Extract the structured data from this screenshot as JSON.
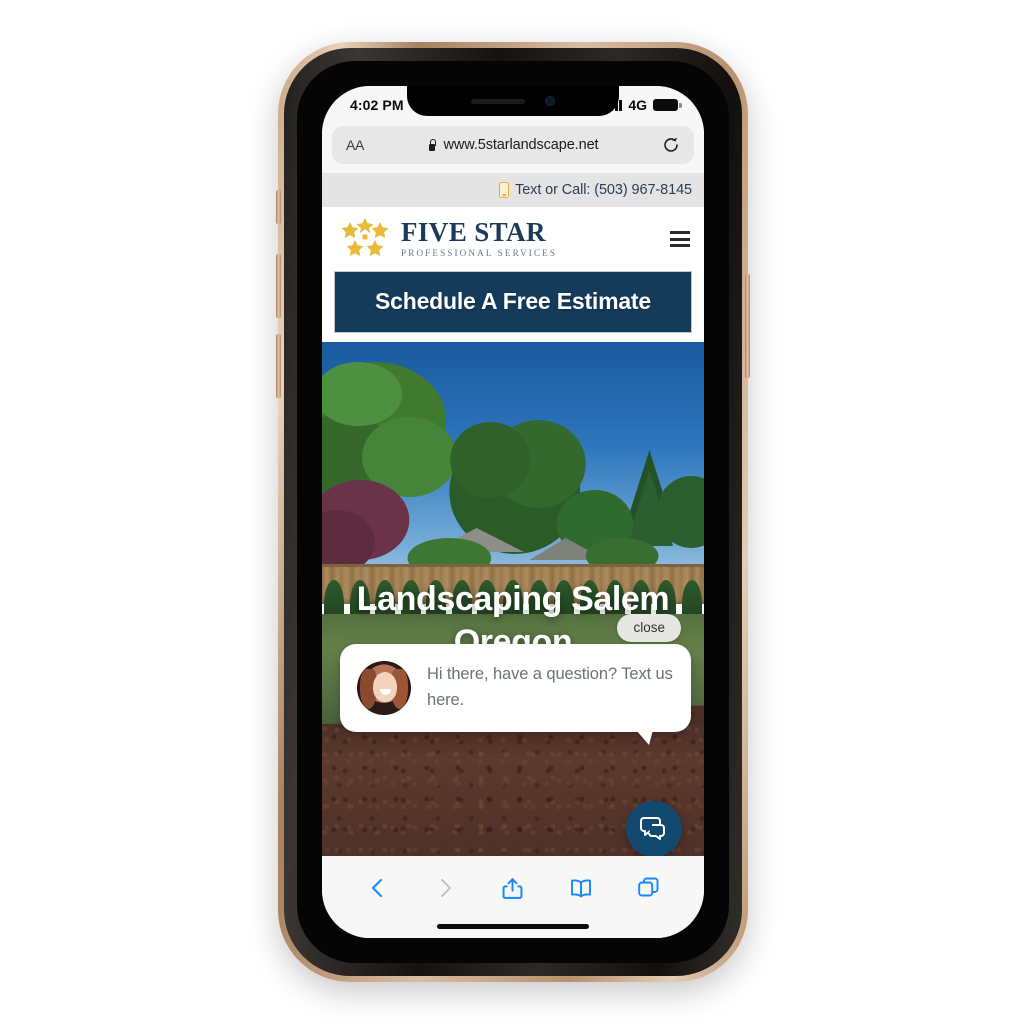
{
  "device": {
    "status_bar": {
      "time": "4:02 PM",
      "network": "4G",
      "signal_icon": "signal-bars-icon",
      "battery_icon": "battery-icon"
    },
    "frame_color": "#c8a584"
  },
  "browser": {
    "name": "Safari",
    "url_bar": {
      "reader_button": "AA",
      "lock_icon": "lock-icon",
      "url": "www.5starlandscape.net",
      "reload_icon": "reload-icon"
    },
    "toolbar": [
      {
        "name": "back-button",
        "icon": "chevron-left-icon",
        "enabled": true,
        "color": "#1a86ff"
      },
      {
        "name": "forward-button",
        "icon": "chevron-right-icon",
        "enabled": false,
        "color": "#c2c2c4"
      },
      {
        "name": "share-button",
        "icon": "share-icon",
        "enabled": true,
        "color": "#1a86ff"
      },
      {
        "name": "bookmarks-button",
        "icon": "book-icon",
        "enabled": true,
        "color": "#1a86ff"
      },
      {
        "name": "tabs-button",
        "icon": "tabs-icon",
        "enabled": true,
        "color": "#1a86ff"
      }
    ]
  },
  "site": {
    "topbar": {
      "phone_icon": "mobile-phone-icon",
      "text": "Text or Call: (503) 967-8145",
      "bg": "#e4e4e4",
      "text_color": "#2c3e50",
      "icon_color": "#e2b13c"
    },
    "header": {
      "logo": {
        "name_line1": "Five Star",
        "name_line2": "Professional Services",
        "star_color": "#e8b93b",
        "text_color": "#1b3a5c"
      },
      "menu_icon": "hamburger-menu-icon"
    },
    "cta": {
      "label": "Schedule A Free Estimate",
      "bg": "#153b5b",
      "text_color": "#ffffff"
    },
    "hero": {
      "headline": "Landscaping Salem Oregon",
      "image_alt": "backyard-landscaping-photo",
      "sky_color": "#2e76bd",
      "lawn_color": "#64804a",
      "mulch_color": "#55342a"
    },
    "chat_widget": {
      "close_label": "close",
      "message": "Hi there, have a question? Text us here.",
      "avatar_name": "agent-avatar",
      "fab_icon": "chat-bubbles-icon",
      "fab_color": "#12496e",
      "message_color": "#6b7279"
    }
  }
}
